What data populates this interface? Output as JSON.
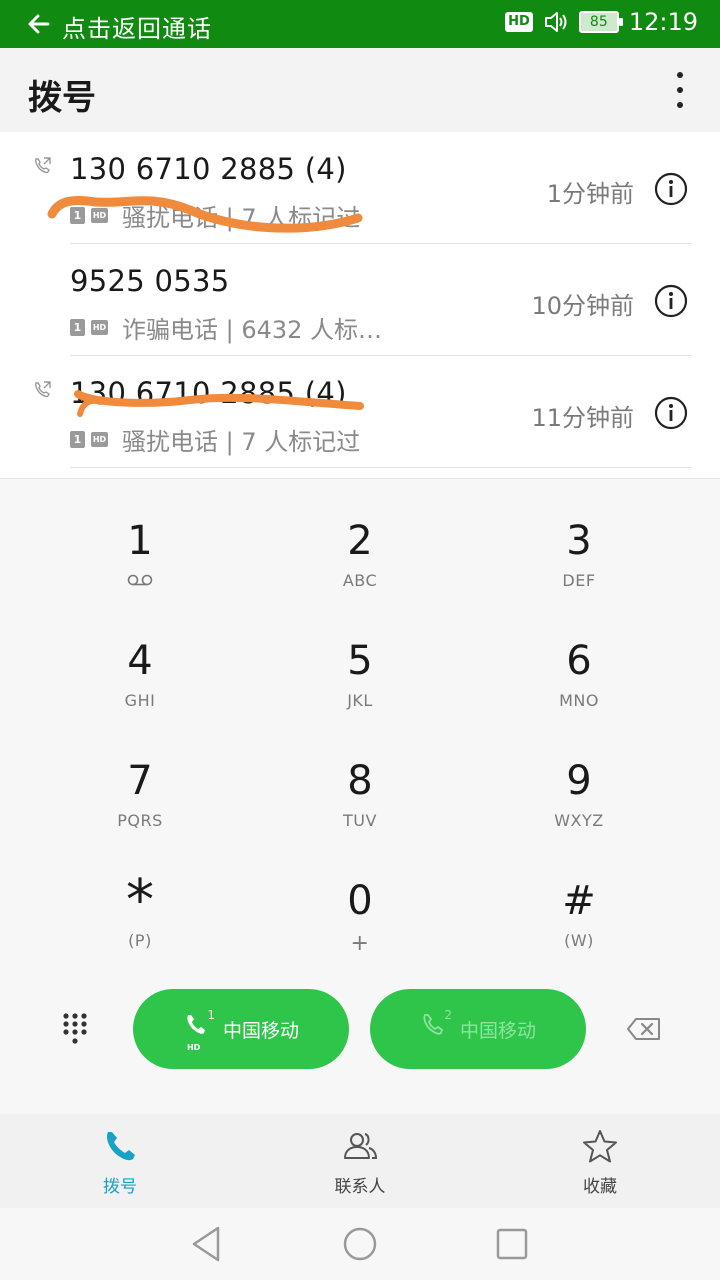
{
  "status_bar": {
    "return_text": "点击返回通话",
    "hd": "HD",
    "battery": "85",
    "time": "12:19"
  },
  "header": {
    "title": "拨号"
  },
  "call_log": [
    {
      "number": "130 6710 2885  (4)",
      "sim": "1",
      "hd": "HD",
      "tag": "骚扰电话 | 7 人标记过",
      "time": "1分钟前",
      "outgoing": true
    },
    {
      "number": "9525 0535",
      "sim": "1",
      "hd": "HD",
      "tag": "诈骗电话 | 6432 人标…",
      "time": "10分钟前",
      "outgoing": false
    },
    {
      "number": "130 6710 2885  (4)",
      "sim": "1",
      "hd": "HD",
      "tag": "骚扰电话 | 7 人标记过",
      "time": "11分钟前",
      "outgoing": true
    }
  ],
  "dialpad": {
    "keys": [
      {
        "digit": "1",
        "letters": ""
      },
      {
        "digit": "2",
        "letters": "ABC"
      },
      {
        "digit": "3",
        "letters": "DEF"
      },
      {
        "digit": "4",
        "letters": "GHI"
      },
      {
        "digit": "5",
        "letters": "JKL"
      },
      {
        "digit": "6",
        "letters": "MNO"
      },
      {
        "digit": "7",
        "letters": "PQRS"
      },
      {
        "digit": "8",
        "letters": "TUV"
      },
      {
        "digit": "9",
        "letters": "WXYZ"
      },
      {
        "digit": "*",
        "letters": "(P)"
      },
      {
        "digit": "0",
        "letters": "+"
      },
      {
        "digit": "#",
        "letters": "(W)"
      }
    ],
    "sim1": {
      "num": "1",
      "hd": "HD",
      "label": "中国移动"
    },
    "sim2": {
      "num": "2",
      "label": "中国移动"
    }
  },
  "tabs": [
    {
      "label": "拨号",
      "icon": "phone-icon",
      "active": true
    },
    {
      "label": "联系人",
      "icon": "contacts-icon",
      "active": false
    },
    {
      "label": "收藏",
      "icon": "star-icon",
      "active": false
    }
  ],
  "colors": {
    "status_bar": "#118a11",
    "call_button": "#2ec54a",
    "active_tab": "#1aa1c6",
    "scribble": "#f08a3c"
  }
}
